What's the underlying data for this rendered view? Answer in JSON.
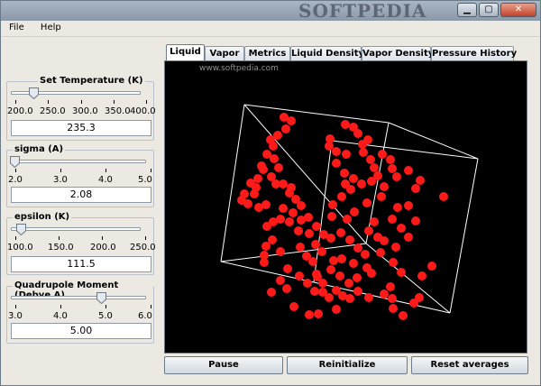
{
  "window": {
    "watermark": "SOFTPEDIA"
  },
  "window_controls": {
    "minimize": "▁",
    "maximize": "▢",
    "close": "✕"
  },
  "menu": {
    "file": "File",
    "help": "Help"
  },
  "temperature": {
    "title": "Set Temperature (K)",
    "ticks": [
      "200.0",
      "250.0",
      "300.0",
      "350.0",
      "400.0"
    ],
    "value": "235.3",
    "fraction": 0.176
  },
  "sigma": {
    "title": "sigma (A)",
    "ticks": [
      "2.0",
      "3.0",
      "4.0",
      "5.0"
    ],
    "value": "2.08",
    "fraction": 0.027
  },
  "epsilon": {
    "title": "epsilon (K)",
    "ticks": [
      "100.0",
      "150.0",
      "200.0",
      "250.0"
    ],
    "value": "111.5",
    "fraction": 0.077
  },
  "quadrupole": {
    "title": "Quadrupole Moment (Debye A)",
    "ticks": [
      "3.0",
      "4.0",
      "5.0",
      "6.0"
    ],
    "value": "5.00",
    "fraction": 0.667
  },
  "tabs": [
    "Liquid",
    "Vapor",
    "Metrics",
    "Liquid Density",
    "Vapor Density",
    "Pressure History"
  ],
  "active_tab": "Liquid",
  "canvas": {
    "watermark": "www.softpedia.com",
    "background": "#000000",
    "particle_color": "#ff1a1a",
    "edge_color": "#ffffff"
  },
  "buttons": {
    "pause": "Pause",
    "reinitialize": "Reinitialize",
    "reset": "Reset averages"
  },
  "colors": {
    "window_bg": "#ece9e2",
    "border": "#8c99a6"
  }
}
